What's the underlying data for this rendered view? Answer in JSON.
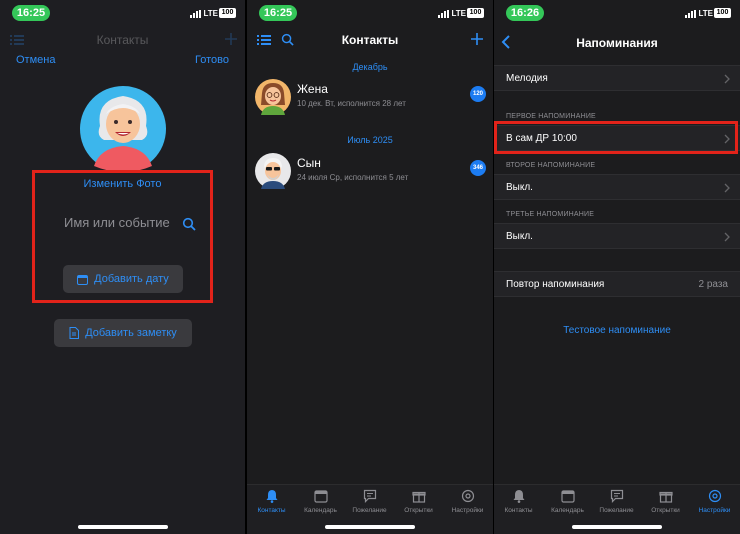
{
  "colors": {
    "accent": "#2e8ef5",
    "highlight": "#e2231a",
    "status_pill": "#34c759"
  },
  "panel1": {
    "status": {
      "time": "16:25",
      "network": "LTE",
      "battery": "100"
    },
    "ghost_title": "Контакты",
    "cancel": "Отмена",
    "done": "Готово",
    "change_photo": "Изменить Фото",
    "name_placeholder": "Имя или событие",
    "add_date": "Добавить дату",
    "add_note": "Добавить заметку"
  },
  "panel2": {
    "status": {
      "time": "16:25",
      "network": "LTE",
      "battery": "100"
    },
    "title": "Контакты",
    "sections": [
      {
        "header": "Декабрь",
        "contact": {
          "name": "Жена",
          "subtitle": "10 дек. Вт, исполнится 28 лет",
          "badge": "120"
        }
      },
      {
        "header": "Июль 2025",
        "contact": {
          "name": "Сын",
          "subtitle": "24 июля Ср, исполнится 5 лет",
          "badge": "346"
        }
      }
    ],
    "tabs": [
      "Контакты",
      "Календарь",
      "Пожелание",
      "Открытки",
      "Настройки"
    ]
  },
  "panel3": {
    "status": {
      "time": "16:26",
      "network": "LTE",
      "battery": "100"
    },
    "title": "Напоминания",
    "melody": "Мелодия",
    "first_header": "ПЕРВОЕ НАПОМИНАНИЕ",
    "first_value": "В сам ДР 10:00",
    "second_header": "ВТОРОЕ НАПОМИНАНИЕ",
    "second_value": "Выкл.",
    "third_header": "ТРЕТЬЕ НАПОМИНАНИЕ",
    "third_value": "Выкл.",
    "repeat_label": "Повтор напоминания",
    "repeat_value": "2 раза",
    "test": "Тестовое напоминание",
    "tabs": [
      "Контакты",
      "Календарь",
      "Пожелание",
      "Открытки",
      "Настройки"
    ]
  }
}
